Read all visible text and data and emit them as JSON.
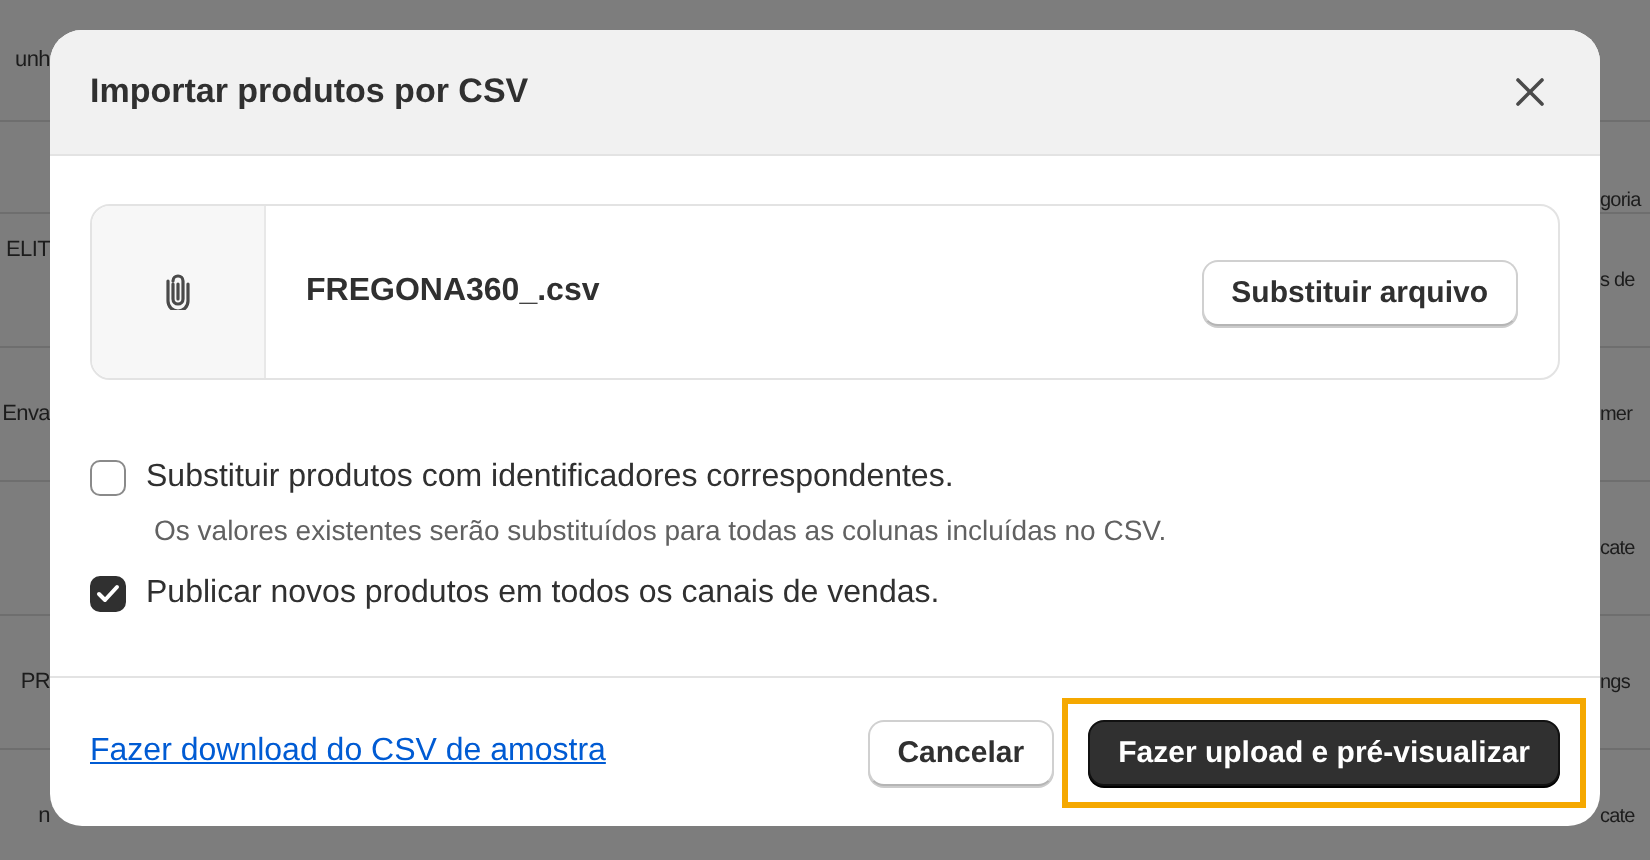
{
  "background": {
    "rows": [
      {
        "left": "unh"
      },
      {
        "right": "goria"
      },
      {
        "left": "ELIT",
        "right": "s de"
      },
      {
        "left": "Enva",
        "right": "mer"
      },
      {
        "right": "cate"
      },
      {
        "left": "PR",
        "right": "ngs"
      },
      {
        "left": "n",
        "right": "cate"
      }
    ]
  },
  "dialog": {
    "title": "Importar produtos por CSV",
    "file": {
      "name": "FREGONA360_.csv",
      "button": "Substituir arquivo"
    },
    "options": [
      {
        "label": "Substituir produtos com identificadores correspondentes.",
        "checked": false,
        "help": "Os valores existentes serão substituídos para todas as colunas incluídas no CSV."
      },
      {
        "label": "Publicar novos produtos em todos os canais de vendas.",
        "checked": true
      }
    ],
    "footer": {
      "link": "Fazer download do CSV de amostra",
      "cancel": "Cancelar",
      "primary": "Fazer upload e pré-visualizar",
      "primary_highlighted": true
    }
  }
}
